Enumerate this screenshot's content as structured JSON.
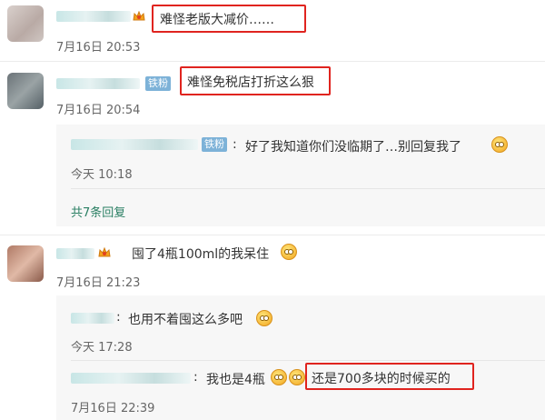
{
  "comments": [
    {
      "text": "难怪老版大减价……",
      "time": "7月16日 20:53"
    },
    {
      "badge": "铁粉",
      "text": "难怪免税店打折这么狠",
      "time": "7月16日 20:54",
      "reply": {
        "badge": "铁粉",
        "colon": ":",
        "text": "好了我知道你们没临期了…别回复我了",
        "time": "今天 10:18"
      },
      "more_replies": "共7条回复"
    },
    {
      "text": "囤了4瓶100ml的我呆住",
      "time": "7月16日 21:23",
      "replies": [
        {
          "colon": ":",
          "text": "也用不着囤这么多吧",
          "time": "今天 17:28"
        },
        {
          "colon": ":",
          "text_a": "我也是4瓶",
          "text_b": "还是700多块的时候买的",
          "time": "7月16日 22:39"
        }
      ]
    }
  ],
  "icons": {
    "crown": "crown-badge-icon",
    "emoji_nerd": "nerd-face-icon",
    "emoji_grin": "grin-face-icon",
    "emoji_laugh": "laugh-tears-icon"
  }
}
